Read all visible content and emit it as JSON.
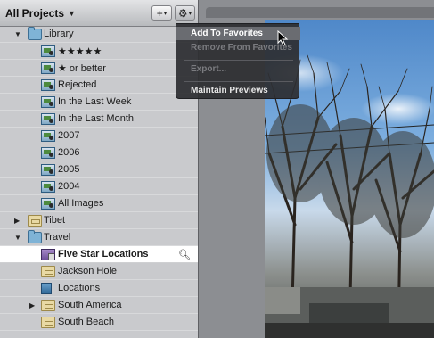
{
  "toolbar": {
    "projects_label": "All Projects",
    "add_label": "+",
    "gear_label": "⚙"
  },
  "library": [
    {
      "label": "Library",
      "kind": "folder",
      "disclosure": "open",
      "indent": 0
    },
    {
      "label": "★★★★★",
      "kind": "album",
      "indent": 1
    },
    {
      "label": "★ or better",
      "kind": "album",
      "indent": 1
    },
    {
      "label": "Rejected",
      "kind": "album",
      "indent": 1
    },
    {
      "label": "In the Last Week",
      "kind": "album",
      "indent": 1
    },
    {
      "label": "In the Last Month",
      "kind": "album",
      "indent": 1
    },
    {
      "label": "2007",
      "kind": "album",
      "indent": 1
    },
    {
      "label": "2006",
      "kind": "album",
      "indent": 1
    },
    {
      "label": "2005",
      "kind": "album",
      "indent": 1
    },
    {
      "label": "2004",
      "kind": "album",
      "indent": 1
    },
    {
      "label": "All Images",
      "kind": "album",
      "indent": 1
    },
    {
      "label": "Tibet",
      "kind": "project",
      "disclosure": "closed",
      "indent": 0
    },
    {
      "label": "Travel",
      "kind": "folder",
      "disclosure": "open",
      "indent": 0
    },
    {
      "label": "Five Star Locations",
      "kind": "smart",
      "indent": 1,
      "selected": true
    },
    {
      "label": "Jackson Hole",
      "kind": "project",
      "indent": 1
    },
    {
      "label": "Locations",
      "kind": "book",
      "indent": 1
    },
    {
      "label": "South America",
      "kind": "project",
      "disclosure": "closed",
      "indent": 1
    },
    {
      "label": "South Beach",
      "kind": "project",
      "indent": 1
    }
  ],
  "menu": {
    "items": [
      {
        "label": "Add To Favorites",
        "state": "highlighted"
      },
      {
        "label": "Remove From Favorites",
        "state": "disabled"
      },
      {
        "label": "Export...",
        "state": "disabled"
      },
      {
        "label": "Maintain Previews",
        "state": "enabled"
      }
    ]
  }
}
